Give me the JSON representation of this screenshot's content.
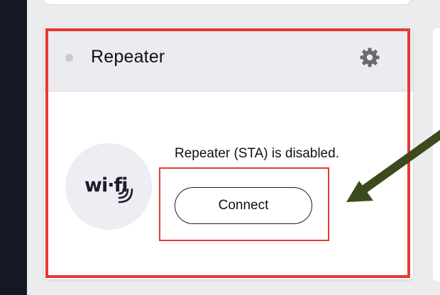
{
  "card": {
    "title": "Repeater",
    "settings_icon": "gear-icon",
    "status_dot_color": "#c9c9ce",
    "wifi_logo_icon": "wifi-logo-icon",
    "status_text": "Repeater (STA) is disabled.",
    "connect_label": "Connect"
  },
  "annotations": {
    "highlight_color": "#e53a2f",
    "arrow_color": "#3d4a1d",
    "arrow_icon": "arrow-icon"
  }
}
